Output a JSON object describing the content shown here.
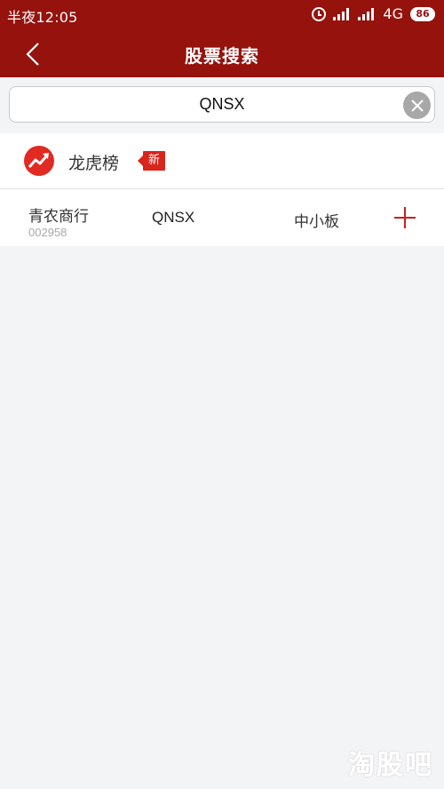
{
  "status_bar": {
    "time": "半夜12:05",
    "network": "4G",
    "network_sub": "ᵢₗ",
    "battery": "86"
  },
  "nav": {
    "title": "股票搜索"
  },
  "search": {
    "value": "QNSX"
  },
  "promo": {
    "label": "龙虎榜",
    "badge": "新"
  },
  "results": [
    {
      "name": "青农商行",
      "code": "002958",
      "abbr": "QNSX",
      "board": "中小板"
    }
  ],
  "watermark": "淘股吧",
  "colors": {
    "header": "#95120d",
    "accent": "#d8261d",
    "background": "#f3f4f6"
  }
}
